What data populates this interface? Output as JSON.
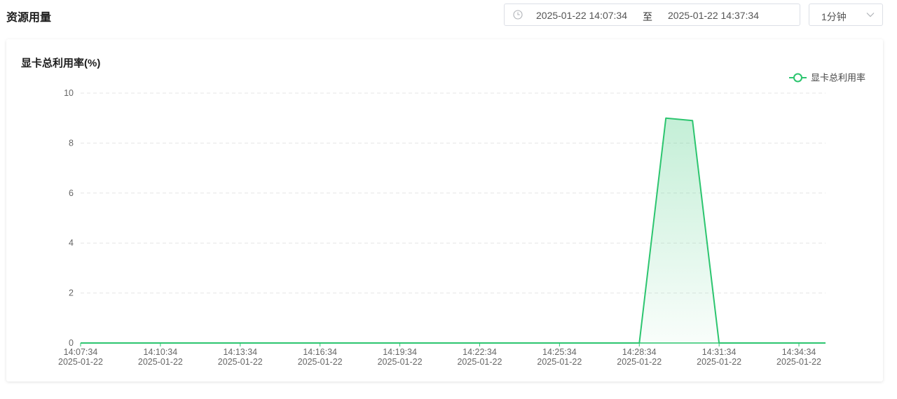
{
  "page": {
    "title": "资源用量"
  },
  "range_picker": {
    "icon": "clock-icon",
    "start": "2025-01-22 14:07:34",
    "separator": "至",
    "end": "2025-01-22 14:37:34"
  },
  "interval_select": {
    "value": "1分钟",
    "icon": "chevron-down-icon"
  },
  "card": {
    "title": "显卡总利用率(%)"
  },
  "colors": {
    "series": "#2cc56f",
    "grid": "#e6e6e6",
    "axis": "#2cc56f"
  },
  "chart_data": {
    "type": "area",
    "title": "显卡总利用率(%)",
    "ylim": [
      0,
      10
    ],
    "yticks": [
      "0",
      "2",
      "4",
      "6",
      "8",
      "10"
    ],
    "grid": true,
    "legend_position": "top-right",
    "x_start": "14:07:34",
    "x_end": "14:35:34",
    "xticks": [
      {
        "time": "14:07:34",
        "date": "2025-01-22"
      },
      {
        "time": "14:10:34",
        "date": "2025-01-22"
      },
      {
        "time": "14:13:34",
        "date": "2025-01-22"
      },
      {
        "time": "14:16:34",
        "date": "2025-01-22"
      },
      {
        "time": "14:19:34",
        "date": "2025-01-22"
      },
      {
        "time": "14:22:34",
        "date": "2025-01-22"
      },
      {
        "time": "14:25:34",
        "date": "2025-01-22"
      },
      {
        "time": "14:28:34",
        "date": "2025-01-22"
      },
      {
        "time": "14:31:34",
        "date": "2025-01-22"
      },
      {
        "time": "14:34:34",
        "date": "2025-01-22"
      }
    ],
    "series": [
      {
        "name": "显卡总利用率",
        "points": [
          {
            "x": "14:07:34",
            "y": 0
          },
          {
            "x": "14:28:34",
            "y": 0
          },
          {
            "x": "14:29:34",
            "y": 9.0
          },
          {
            "x": "14:30:34",
            "y": 8.9
          },
          {
            "x": "14:31:34",
            "y": 0
          },
          {
            "x": "14:35:34",
            "y": 0
          }
        ]
      }
    ]
  }
}
